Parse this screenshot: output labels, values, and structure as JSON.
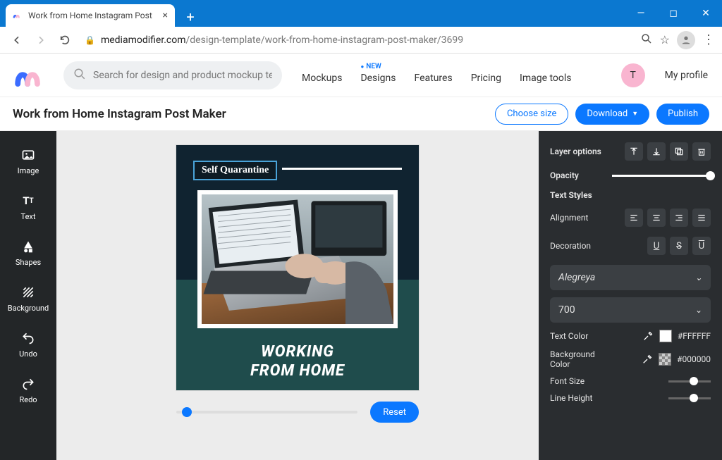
{
  "browser": {
    "tab_title": "Work from Home Instagram Post",
    "url_domain": "mediamodifier.com",
    "url_path": "/design-template/work-from-home-instagram-post-maker/3699"
  },
  "header": {
    "search_placeholder": "Search for design and product mockup templ",
    "nav": {
      "mockups": "Mockups",
      "designs": "Designs",
      "designs_badge": "NEW",
      "features": "Features",
      "pricing": "Pricing",
      "image_tools": "Image tools"
    },
    "avatar_initial": "T",
    "profile_label": "My profile"
  },
  "titlebar": {
    "page_title": "Work from Home Instagram Post Maker",
    "choose_size": "Choose size",
    "download": "Download",
    "publish": "Publish"
  },
  "tools": {
    "image": "Image",
    "text": "Text",
    "shapes": "Shapes",
    "background": "Background",
    "undo": "Undo",
    "redo": "Redo"
  },
  "canvas": {
    "badge_text": "Self Quarantine",
    "headline_line1": "WORKING",
    "headline_line2": "FROM HOME",
    "reset": "Reset"
  },
  "panel": {
    "layer_options": "Layer options",
    "opacity": "Opacity",
    "text_styles": "Text Styles",
    "alignment": "Alignment",
    "decoration": "Decoration",
    "font_family": "Alegreya",
    "font_weight": "700",
    "text_color_label": "Text Color",
    "text_color_value": "#FFFFFF",
    "bg_color_label": "Background Color",
    "bg_color_value": "#000000",
    "font_size": "Font Size",
    "line_height": "Line Height"
  }
}
